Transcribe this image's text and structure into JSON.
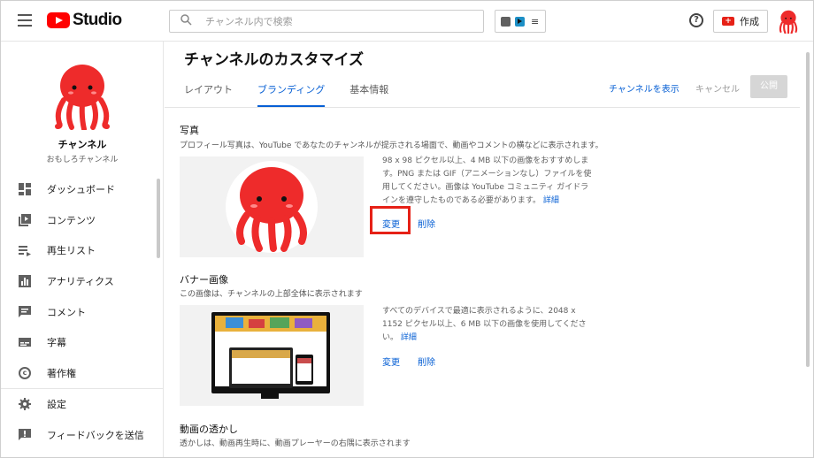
{
  "topbar": {
    "logo_text": "Studio",
    "search_placeholder": "チャンネル内で検索",
    "create_label": "作成"
  },
  "sidebar": {
    "channel_name": "チャンネル",
    "channel_sub": "おもしろチャンネル",
    "items": [
      {
        "label": "ダッシュボード",
        "icon": "dashboard-icon"
      },
      {
        "label": "コンテンツ",
        "icon": "content-icon"
      },
      {
        "label": "再生リスト",
        "icon": "playlist-icon"
      },
      {
        "label": "アナリティクス",
        "icon": "analytics-icon"
      },
      {
        "label": "コメント",
        "icon": "comment-icon"
      },
      {
        "label": "字幕",
        "icon": "subtitles-icon"
      },
      {
        "label": "著作権",
        "icon": "copyright-icon"
      }
    ],
    "bottom_items": [
      {
        "label": "設定",
        "icon": "gear-icon"
      },
      {
        "label": "フィードバックを送信",
        "icon": "feedback-icon"
      }
    ]
  },
  "main": {
    "title": "チャンネルのカスタマイズ",
    "tabs": [
      "レイアウト",
      "ブランディング",
      "基本情報"
    ],
    "active_tab": "ブランディング",
    "view_channel": "チャンネルを表示",
    "cancel": "キャンセル",
    "publish": "公開",
    "photo": {
      "title": "写真",
      "desc": "プロフィール写真は、YouTube であなたのチャンネルが提示される場面で、動画やコメントの横などに表示されます。",
      "info": "98 x 98 ピクセル以上、4 MB 以下の画像をおすすめします。PNG または GIF（アニメーションなし）ファイルを使用してください。画像は YouTube コミュニティ ガイドラインを遵守したものである必要があります。",
      "info_link": "詳細",
      "change": "変更",
      "delete": "削除"
    },
    "banner": {
      "title": "バナー画像",
      "desc": "この画像は、チャンネルの上部全体に表示されます",
      "info": "すべてのデバイスで最適に表示されるように、2048 x 1152 ピクセル以上、6 MB 以下の画像を使用してください。",
      "info_link": "詳細",
      "change": "変更",
      "delete": "削除"
    },
    "watermark": {
      "title": "動画の透かし",
      "desc": "透かしは、動画再生時に、動画プレーヤーの右隅に表示されます"
    }
  },
  "colors": {
    "accent": "#065fd4",
    "brand_red": "#ff0000",
    "highlight_red": "#e62117",
    "octopus_red": "#ee2b2b"
  }
}
